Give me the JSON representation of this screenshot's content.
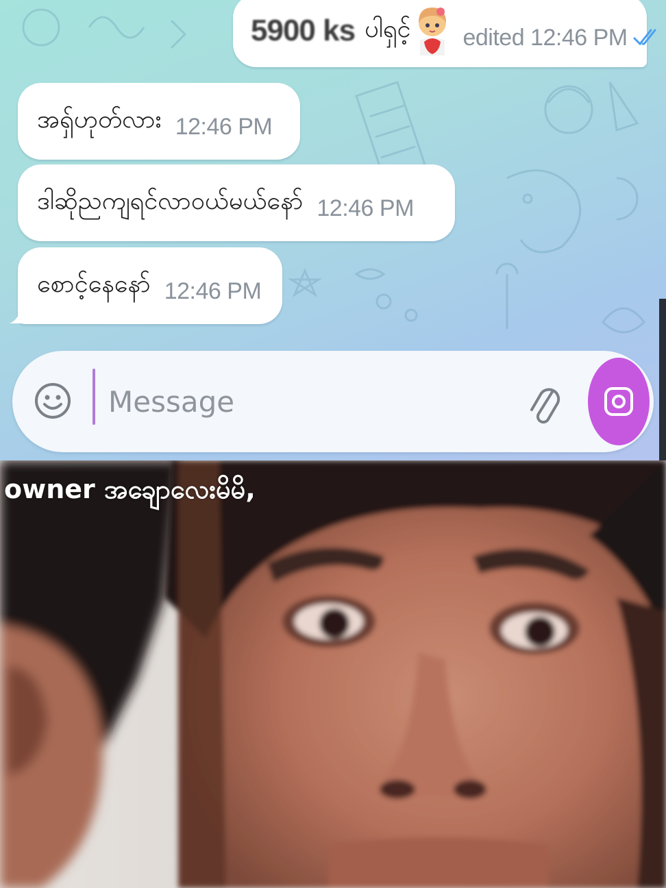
{
  "chat": {
    "messages": [
      {
        "direction": "outgoing",
        "price": "5900 ks",
        "text": "ပါရှင့်",
        "edited_label": "edited 12:46 PM",
        "sticker": "chibi-girl-sticker",
        "status_icon": "double-check-icon"
      },
      {
        "direction": "incoming",
        "text": "အရှ်ဟုတ်လား",
        "time": "12:46 PM"
      },
      {
        "direction": "incoming",
        "text": "ဒါဆိုညကျရင်လာဝယ်မယ်နော်",
        "time": "12:46 PM"
      },
      {
        "direction": "incoming",
        "text": "စောင့်နေနော်",
        "time": "12:46 PM"
      }
    ]
  },
  "input_bar": {
    "placeholder": "Message",
    "value": "",
    "emoji_icon": "smiley-icon",
    "attach_icon": "paperclip-icon",
    "camera_icon": "camera-icon"
  },
  "meme": {
    "caption": "owner အချောလေးမိမိ,"
  },
  "colors": {
    "chat_background": "#a9dcdf",
    "bubble": "#ffffff",
    "timestamp": "#8a929b",
    "read_check": "#4a9ff0",
    "camera_button": "#c658e0",
    "caret": "#b07cd6"
  }
}
